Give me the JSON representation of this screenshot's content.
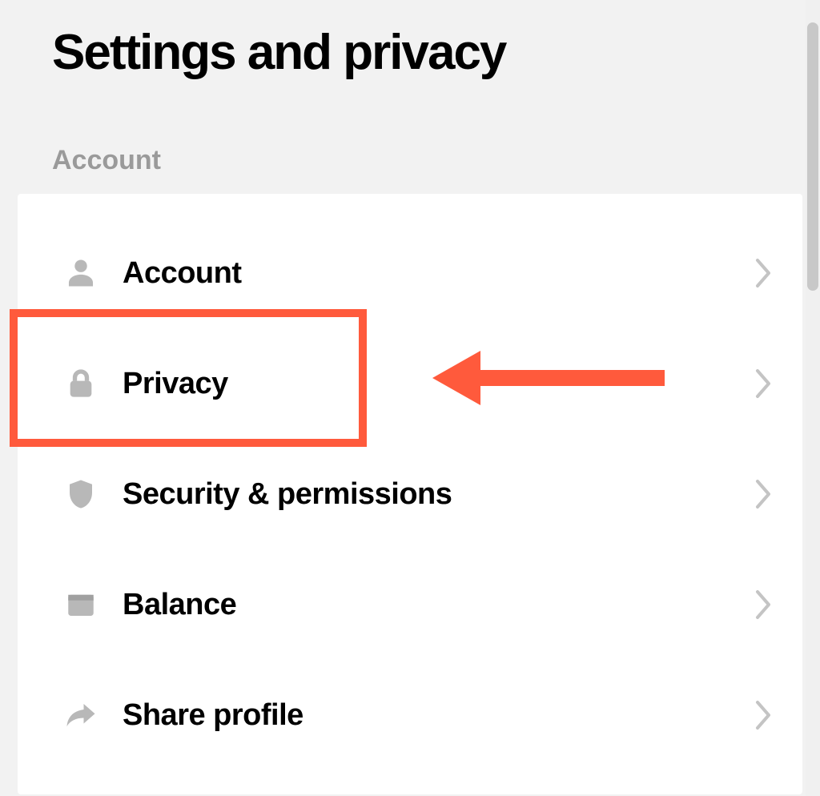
{
  "page_title": "Settings and privacy",
  "section_label": "Account",
  "rows": [
    {
      "icon": "person-icon",
      "label": "Account"
    },
    {
      "icon": "lock-icon",
      "label": "Privacy"
    },
    {
      "icon": "shield-icon",
      "label": "Security & permissions"
    },
    {
      "icon": "wallet-icon",
      "label": "Balance"
    },
    {
      "icon": "share-icon",
      "label": "Share profile"
    }
  ],
  "annotation": {
    "highlight_color": "#ff5a3c",
    "arrow_color": "#ff5a3c"
  }
}
